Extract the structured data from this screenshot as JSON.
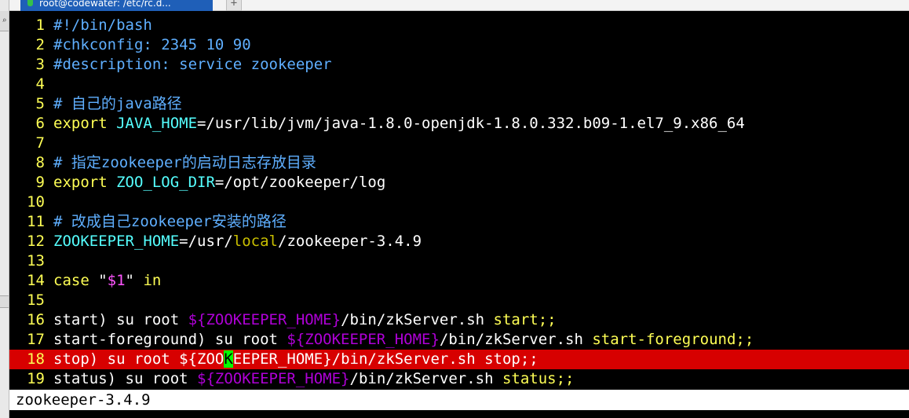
{
  "window": {
    "tab_title": "root@codewater: /etc/rc.d...",
    "add_tab": "+"
  },
  "editor": {
    "current_line": 18,
    "cursor": {
      "line": 18,
      "column": 12
    },
    "lines": [
      {
        "n": "1",
        "segs": [
          {
            "t": "#!/bin/bash",
            "c": "comment"
          }
        ]
      },
      {
        "n": "2",
        "segs": [
          {
            "t": "#chkconfig: 2345 10 90",
            "c": "comment"
          }
        ]
      },
      {
        "n": "3",
        "segs": [
          {
            "t": "#description: service zookeeper",
            "c": "comment"
          }
        ]
      },
      {
        "n": "4",
        "segs": []
      },
      {
        "n": "5",
        "segs": [
          {
            "t": "# 自己的java路径",
            "c": "comment"
          }
        ]
      },
      {
        "n": "6",
        "segs": [
          {
            "t": "export ",
            "c": "kw"
          },
          {
            "t": "JAVA_HOME",
            "c": "var"
          },
          {
            "t": "=/usr/lib/jvm/java-1.8.0-openjdk-1.8.0.332.b09-1.el7_9.x86_64",
            "c": "plain"
          }
        ]
      },
      {
        "n": "7",
        "segs": []
      },
      {
        "n": "8",
        "segs": [
          {
            "t": "# 指定zookeeper的启动日志存放目录",
            "c": "comment"
          }
        ]
      },
      {
        "n": "9",
        "segs": [
          {
            "t": "export ",
            "c": "kw"
          },
          {
            "t": "ZOO_LOG_DIR",
            "c": "var"
          },
          {
            "t": "=/opt/zookeeper/log",
            "c": "plain"
          }
        ]
      },
      {
        "n": "10",
        "segs": []
      },
      {
        "n": "11",
        "segs": [
          {
            "t": "# 改成自己zookeeper安装的路径",
            "c": "comment"
          }
        ]
      },
      {
        "n": "12",
        "segs": [
          {
            "t": "ZOOKEEPER_HOME",
            "c": "var"
          },
          {
            "t": "=/usr/",
            "c": "plain"
          },
          {
            "t": "local",
            "c": "local"
          },
          {
            "t": "/zookeeper-3.4.9",
            "c": "plain"
          }
        ]
      },
      {
        "n": "13",
        "segs": []
      },
      {
        "n": "14",
        "segs": [
          {
            "t": "case ",
            "c": "kw"
          },
          {
            "t": "\"",
            "c": "plain"
          },
          {
            "t": "$1",
            "c": "str"
          },
          {
            "t": "\"",
            "c": "plain"
          },
          {
            "t": " in",
            "c": "kw"
          }
        ]
      },
      {
        "n": "15",
        "segs": []
      },
      {
        "n": "16",
        "segs": [
          {
            "t": "start) su root ",
            "c": "plain"
          },
          {
            "t": "${ZOOKEEPER_HOME}",
            "c": "sub"
          },
          {
            "t": "/bin/zkServer.sh ",
            "c": "plain"
          },
          {
            "t": "start;;",
            "c": "stmt"
          }
        ]
      },
      {
        "n": "17",
        "segs": [
          {
            "t": "start-foreground",
            "c": "plain"
          },
          {
            "t": ") su root ",
            "c": "plain"
          },
          {
            "t": "${ZOOKEEPER_HOME}",
            "c": "sub"
          },
          {
            "t": "/bin/zkServer.sh ",
            "c": "plain"
          },
          {
            "t": "start-foreground;;",
            "c": "stmt"
          }
        ]
      },
      {
        "n": "18",
        "segs": [
          {
            "t": "stop) su root ${ZOO",
            "c": "plain"
          },
          {
            "t": "K",
            "c": "cursor"
          },
          {
            "t": "EEPER_HOME}/bin/zkServer.sh stop;;",
            "c": "plain"
          }
        ]
      },
      {
        "n": "19",
        "segs": [
          {
            "t": "status) su root ",
            "c": "plain"
          },
          {
            "t": "${ZOOKEEPER_HOME}",
            "c": "sub"
          },
          {
            "t": "/bin/zkServer.sh ",
            "c": "plain"
          },
          {
            "t": "status;;",
            "c": "stmt"
          }
        ]
      }
    ]
  },
  "command_line": {
    "text": "zookeeper-3.4.9"
  },
  "colors": {
    "background": "#000000",
    "line_number": "#ffff55",
    "comment": "#5fafff",
    "keyword": "#ffff55",
    "variable": "#55ffff",
    "substitution": "#af00d7",
    "current_line_highlight": "#d70000",
    "cursor": "#00ff00",
    "tab_active": "#1f5fb8"
  }
}
